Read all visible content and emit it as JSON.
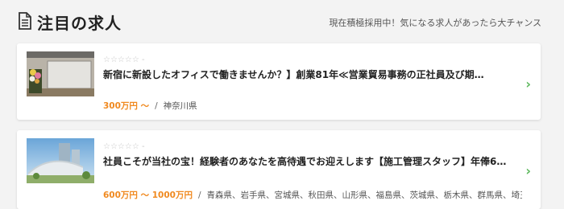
{
  "header": {
    "title": "注目の求人",
    "subtitle": "現在積極採用中！気になる求人があったら大チャンス",
    "icon": "document-icon"
  },
  "jobs": [
    {
      "stars": "☆☆☆☆☆ -",
      "title": "新宿に新設したオフィスで働きませんか？】創業81年≪営業貿易事務の正社員及び期…",
      "salary": "300万円 ～",
      "separator": "/",
      "location": "神奈川県"
    },
    {
      "stars": "☆☆☆☆☆ -",
      "title": "社員こそが当社の宝！経験者のあなたを高待遇でお迎えします【施工管理スタッフ】年俸6…",
      "salary": "600万円 ～ 1000万円",
      "separator": "/",
      "location": "青森県、岩手県、宮城県、秋田県、山形県、福島県、茨城県、栃木県、群馬県、埼玉県、千葉…"
    }
  ],
  "colors": {
    "salary": "#f0891f",
    "chevron": "#5cb85c"
  }
}
